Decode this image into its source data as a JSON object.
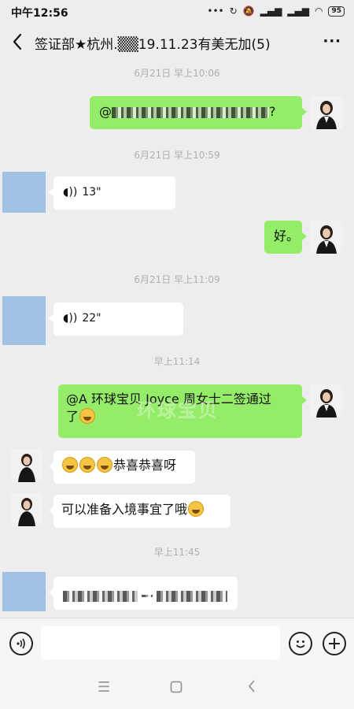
{
  "status_bar": {
    "time": "中午12:56",
    "battery": "95",
    "signal_icons": [
      "dots-icon",
      "sync-icon",
      "mute-icon",
      "signal-icon",
      "signal-icon",
      "wifi-icon"
    ]
  },
  "header": {
    "title": "签证部★杭州.▒▒19.11.23有美无加(5)",
    "more_label": "···"
  },
  "messages": [
    {
      "type": "timestamp",
      "text": "6月21日 早上10:06"
    },
    {
      "type": "out",
      "text": "@▒▒▒▒▒▒▒▒▒▒▒▒▒▒?"
    },
    {
      "type": "timestamp",
      "text": "6月21日 早上10:59"
    },
    {
      "type": "in-voice",
      "duration": "13\""
    },
    {
      "type": "out",
      "text": "好。"
    },
    {
      "type": "timestamp",
      "text": "6月21日 早上11:09"
    },
    {
      "type": "in-voice",
      "duration": "22\""
    },
    {
      "type": "timestamp",
      "text": "早上11:14"
    },
    {
      "type": "out",
      "text_line1": "@A 环球宝贝 Joyce 周女士二签通过",
      "text_line2": "了"
    },
    {
      "type": "in",
      "text": "恭喜恭喜呀"
    },
    {
      "type": "in",
      "text": "可以准备入境事宜了哦"
    },
    {
      "type": "timestamp",
      "text": "早上11:45"
    },
    {
      "type": "in-blurred",
      "text": "▒▒▒▒▒▒▒▒▒▒▒▒"
    }
  ],
  "watermark": {
    "line1": "环球宝贝"
  },
  "input_bar": {
    "placeholder": ""
  },
  "colors": {
    "background": "#ededed",
    "outgoing_bubble": "#95ec69",
    "incoming_bubble": "#ffffff",
    "timestamp": "#b0b0b0",
    "placeholder_avatar": "#a1c0e6"
  }
}
